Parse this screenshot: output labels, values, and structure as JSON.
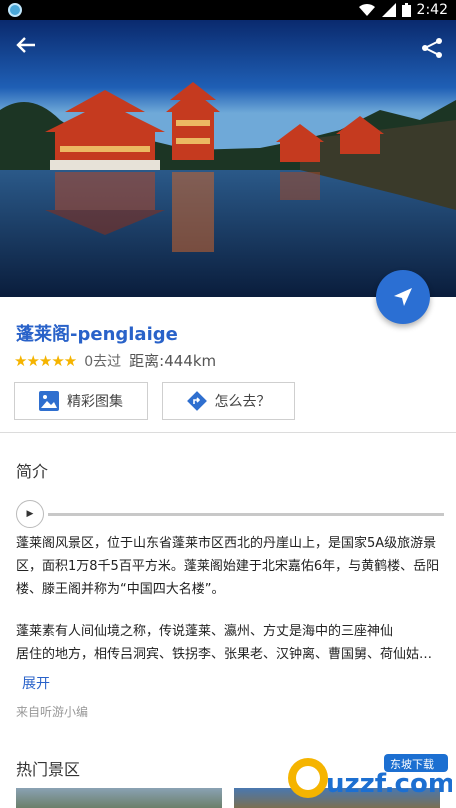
{
  "statusbar": {
    "time": "2:42"
  },
  "header": {
    "back_icon": "arrow-left-icon",
    "share_icon": "share-icon"
  },
  "colors": {
    "accent": "#2962c9",
    "fab": "#2b6fd3",
    "star": "#f5b400"
  },
  "spot": {
    "title": "蓬莱阁-penglaige",
    "rating": 5,
    "stars_text": "★★★★★",
    "visited": "0去过",
    "distance": "距离:444km"
  },
  "actions": {
    "gallery_label": "精彩图集",
    "route_label": "怎么去？"
  },
  "intro": {
    "section_title": "简介",
    "paragraph1": "蓬莱阁风景区，位于山东省蓬莱市区西北的丹崖山上，是国家5A级旅游景区，面积1万8千5百平方米。蓬莱阁始建于北宋嘉佑6年，与黄鹤楼、岳阳楼、滕王阁并称为“中国四大名楼”。",
    "paragraph2_line1": "蓬莱素有人间仙境之称，传说蓬莱、瀛州、方丈是海中的三座神仙",
    "paragraph2_line2": "居住的地方，相传吕洞宾、铁拐李、张果老、汉钟离、曹国舅、荷仙姑、...采",
    "expand_label": "展开",
    "source": "来自听游小编"
  },
  "hot": {
    "section_title": "热门景区"
  },
  "watermark": {
    "text_main": "uzzf.com",
    "text_badge": "东坡下载"
  }
}
